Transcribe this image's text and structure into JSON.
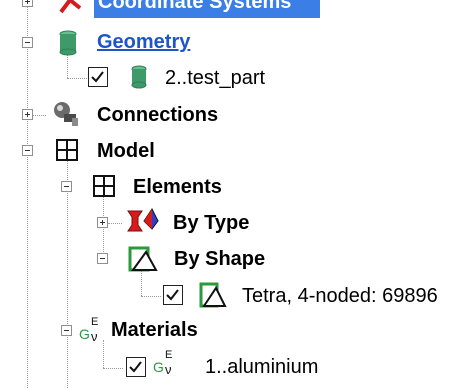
{
  "tree": {
    "coordinate_systems": {
      "label": "Coordinate Systems"
    },
    "geometry": {
      "label": "Geometry",
      "children": [
        {
          "label": "2..test_part",
          "checked": true
        }
      ]
    },
    "connections": {
      "label": "Connections"
    },
    "model": {
      "label": "Model",
      "elements": {
        "label": "Elements",
        "by_type": {
          "label": "By Type"
        },
        "by_shape": {
          "label": "By Shape",
          "children": [
            {
              "label": "Tetra, 4-noded: 69896",
              "checked": true
            }
          ]
        }
      },
      "materials": {
        "label": "Materials",
        "children": [
          {
            "label": "1..aluminium",
            "checked": true
          }
        ]
      }
    }
  },
  "colors": {
    "selection": "#3a7ee6",
    "link": "#1d56c8",
    "geometry_icon": "#3f9a6a",
    "by_type_red": "#d71b1b",
    "by_type_blue": "#2d3fd1",
    "shape_green": "#2a9a3c"
  },
  "icons": {
    "coordinate_systems": "axes-icon",
    "geometry": "cylinder-icon",
    "connections": "connector-icon",
    "model": "grid-icon",
    "elements": "grid-icon",
    "by_type": "element-type-icon",
    "by_shape": "tetra-shape-icon",
    "materials": "material-icon"
  }
}
